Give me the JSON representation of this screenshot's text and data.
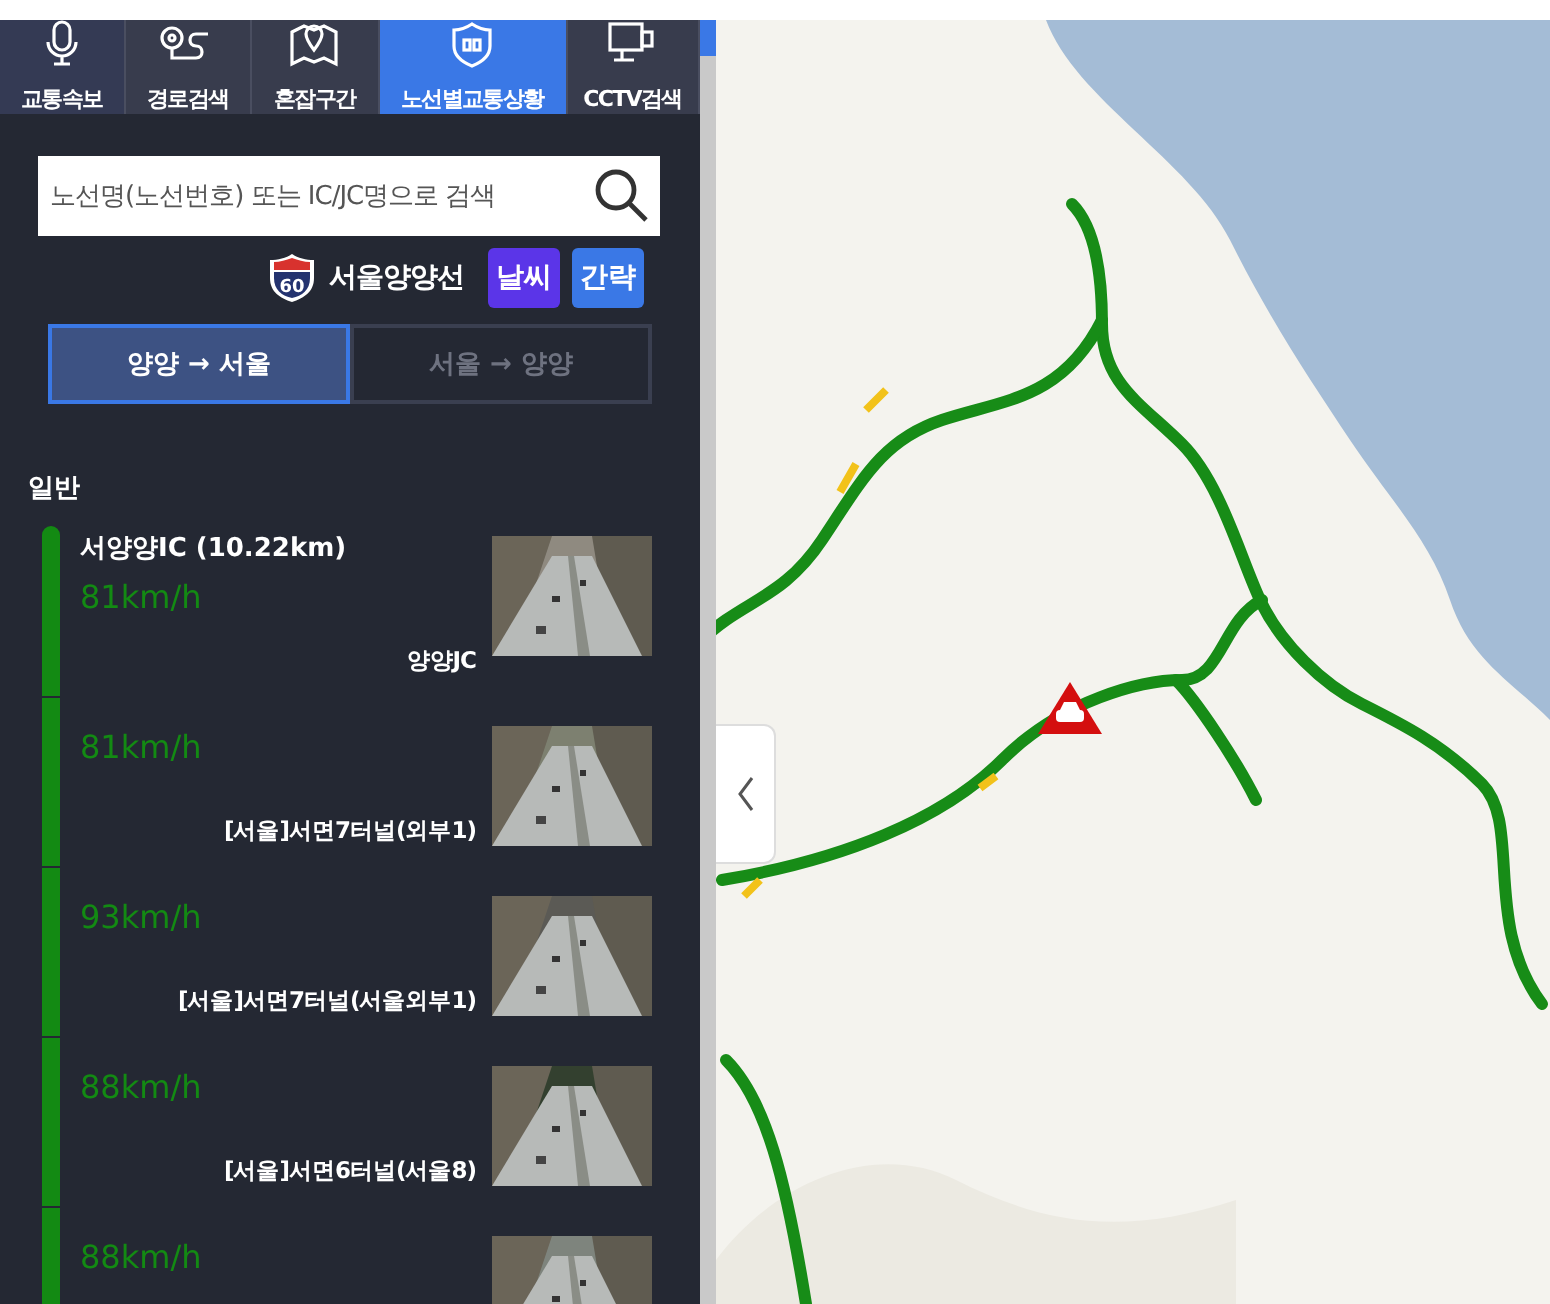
{
  "tabs": [
    {
      "label": "교통속보",
      "selected": false
    },
    {
      "label": "경로검색",
      "selected": false
    },
    {
      "label": "혼잡구간",
      "selected": false
    },
    {
      "label": "노선별교통상황",
      "selected": true
    },
    {
      "label": "CCTV검색",
      "selected": false
    }
  ],
  "search": {
    "placeholder": "노선명(노선번호) 또는 IC/JC명으로 검색"
  },
  "route": {
    "number": "60",
    "name": "서울양양선"
  },
  "route_buttons": [
    {
      "label": "날씨",
      "color": "#5b35e8"
    },
    {
      "label": "간략",
      "color": "#3a78e6"
    }
  ],
  "directions": [
    {
      "label": "양양 → 서울",
      "selected": true
    },
    {
      "label": "서울 → 양양",
      "selected": false
    }
  ],
  "section_title": "일반",
  "segments": [
    {
      "title": "서양양IC (10.22km)",
      "speed": "81km/h",
      "camera": "양양JC",
      "color": "#138a13"
    },
    {
      "speed": "81km/h",
      "camera": "[서울]서면7터널(외부1)",
      "color": "#138a13"
    },
    {
      "speed": "93km/h",
      "camera": "[서울]서면7터널(서울외부1)",
      "color": "#138a13"
    },
    {
      "speed": "88km/h",
      "camera": "[서울]서면6터널(서울8)",
      "color": "#138a13"
    },
    {
      "speed": "88km/h",
      "color": "#138a13"
    }
  ]
}
